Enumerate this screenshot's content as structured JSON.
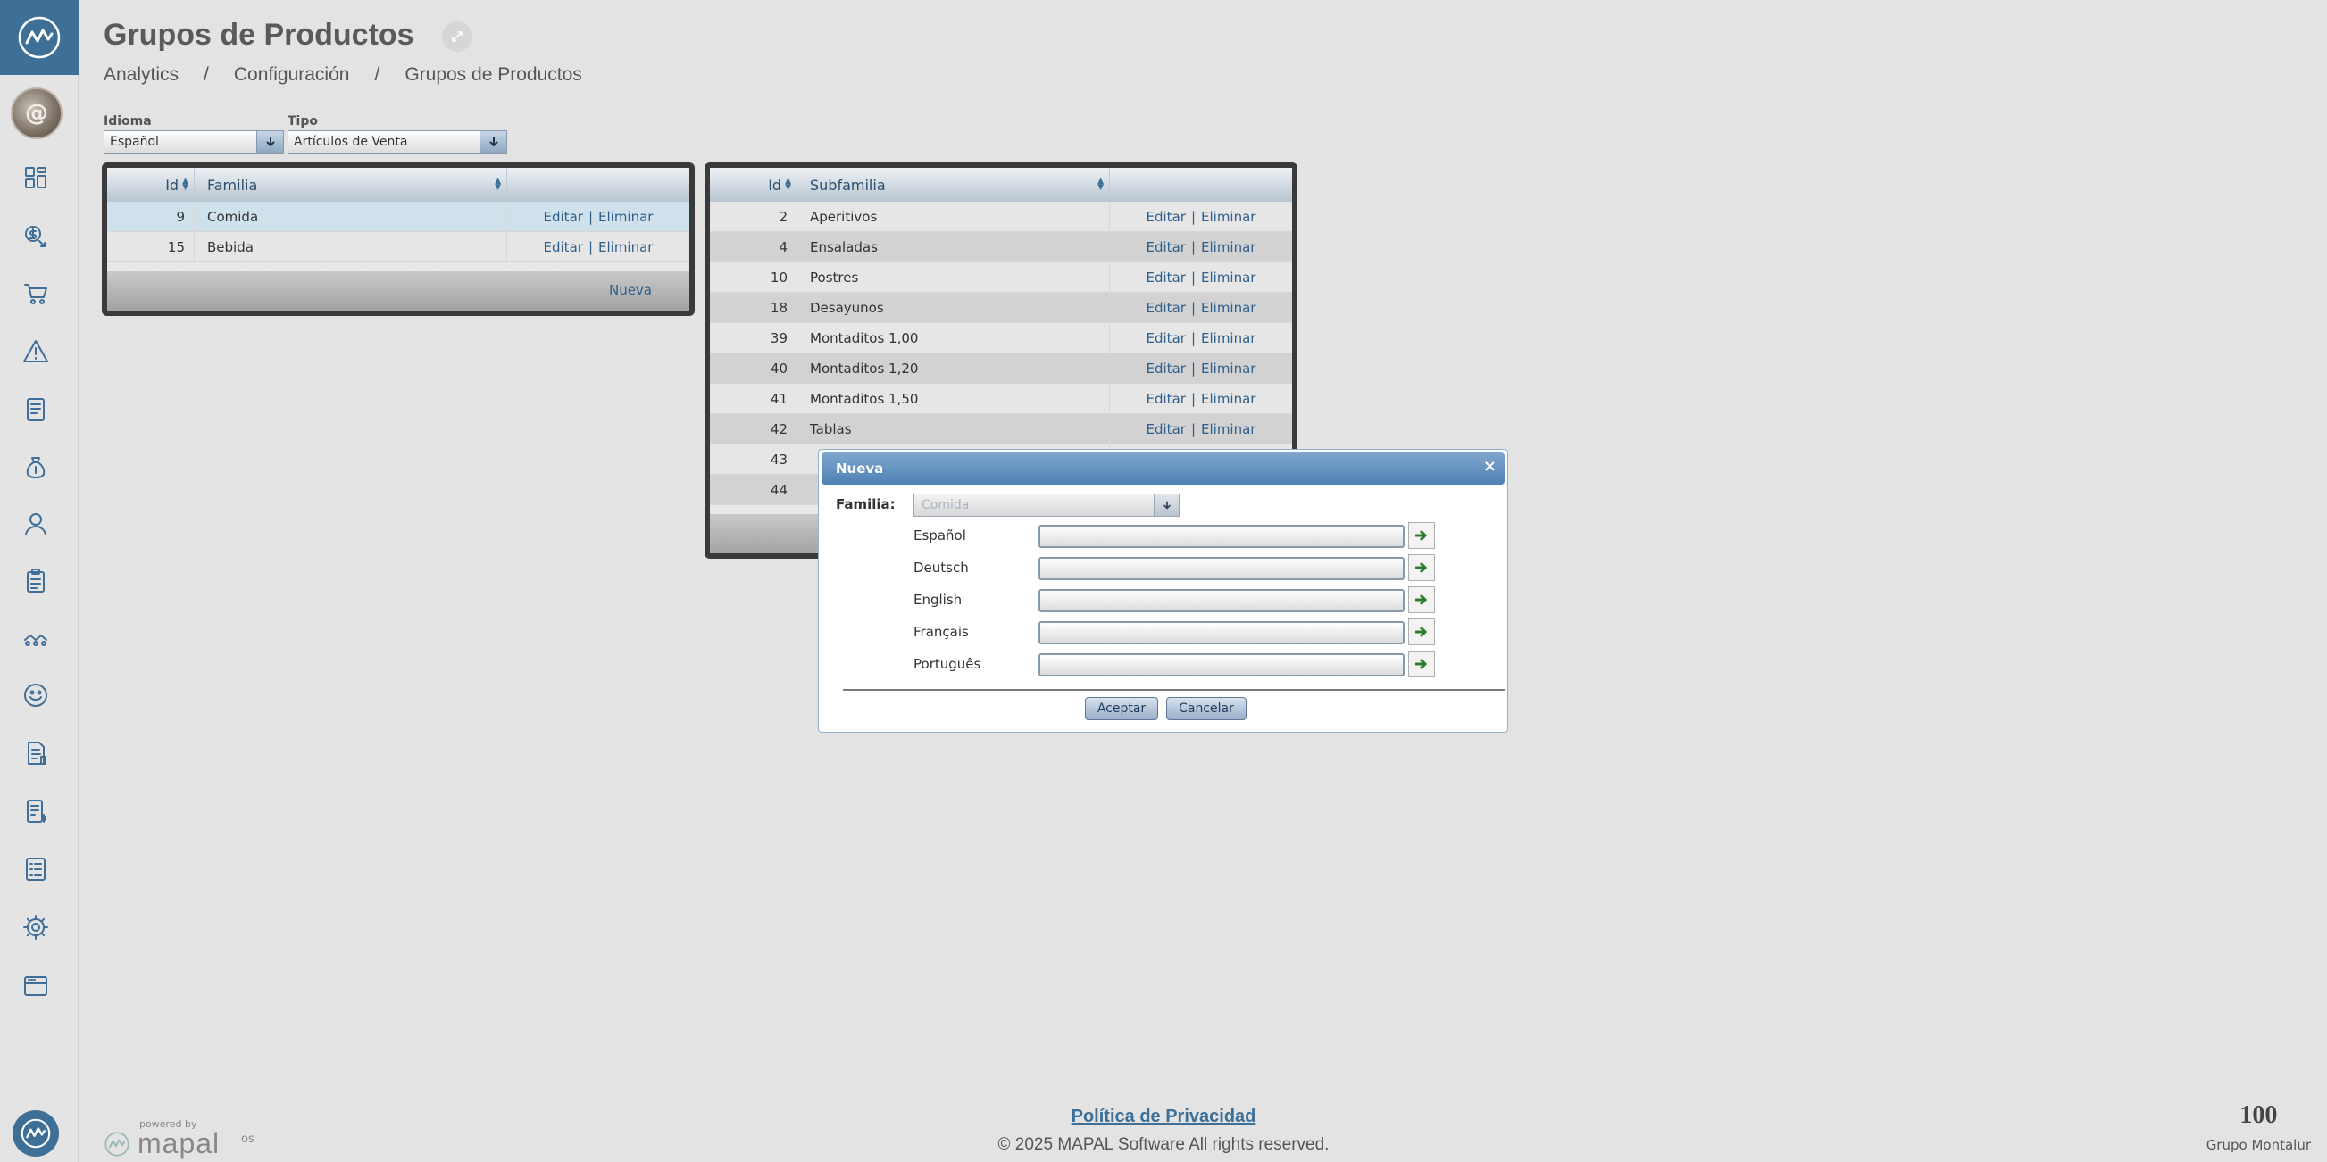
{
  "header": {
    "title": "Grupos de Productos",
    "breadcrumb": [
      "Analytics",
      "Configuración",
      "Grupos de Productos"
    ]
  },
  "sidebar": {
    "items": [
      "dashboard-icon",
      "sales-icon",
      "cart-icon",
      "alert-icon",
      "report-icon",
      "money-bag-icon",
      "user-icon",
      "clipboard-icon",
      "analytics-icon",
      "smile-icon",
      "invoice-icon",
      "receipt-icon",
      "list-icon",
      "settings-icon",
      "browser-icon"
    ]
  },
  "filters": {
    "idioma_label": "Idioma",
    "idioma_value": "Español",
    "tipo_label": "Tipo",
    "tipo_value": "Artículos de Venta"
  },
  "familias": {
    "headers": {
      "id": "Id",
      "name": "Familia"
    },
    "rows": [
      {
        "id": "9",
        "name": "Comida"
      },
      {
        "id": "15",
        "name": "Bebida"
      }
    ],
    "edit_label": "Editar",
    "delete_label": "Eliminar",
    "separator": "|",
    "new_label": "Nueva"
  },
  "subfamilias": {
    "headers": {
      "id": "Id",
      "name": "Subfamilia"
    },
    "rows": [
      {
        "id": "2",
        "name": "Aperitivos"
      },
      {
        "id": "4",
        "name": "Ensaladas"
      },
      {
        "id": "10",
        "name": "Postres"
      },
      {
        "id": "18",
        "name": "Desayunos"
      },
      {
        "id": "39",
        "name": "Montaditos 1,00"
      },
      {
        "id": "40",
        "name": "Montaditos 1,20"
      },
      {
        "id": "41",
        "name": "Montaditos 1,50"
      },
      {
        "id": "42",
        "name": "Tablas"
      },
      {
        "id": "43",
        "name": ""
      },
      {
        "id": "44",
        "name": ""
      }
    ],
    "edit_label": "Editar",
    "delete_label": "Eliminar",
    "separator": "|"
  },
  "dialog": {
    "title": "Nueva",
    "close": "×",
    "familia_label": "Familia:",
    "familia_value": "Comida",
    "languages": [
      "Español",
      "Deutsch",
      "English",
      "Français",
      "Português"
    ],
    "accept_label": "Aceptar",
    "cancel_label": "Cancelar"
  },
  "footer": {
    "powered_by": "powered by",
    "brand": "mapal",
    "brand_suffix": "os",
    "privacy": "Política de Privacidad",
    "copyright": "© 2025 MAPAL Software All rights reserved.",
    "company_logo": "100",
    "company_name": "Grupo Montalur"
  },
  "colors": {
    "accent": "#3d6f97",
    "link": "#2f5f8c",
    "background": "#e3e3e3"
  }
}
